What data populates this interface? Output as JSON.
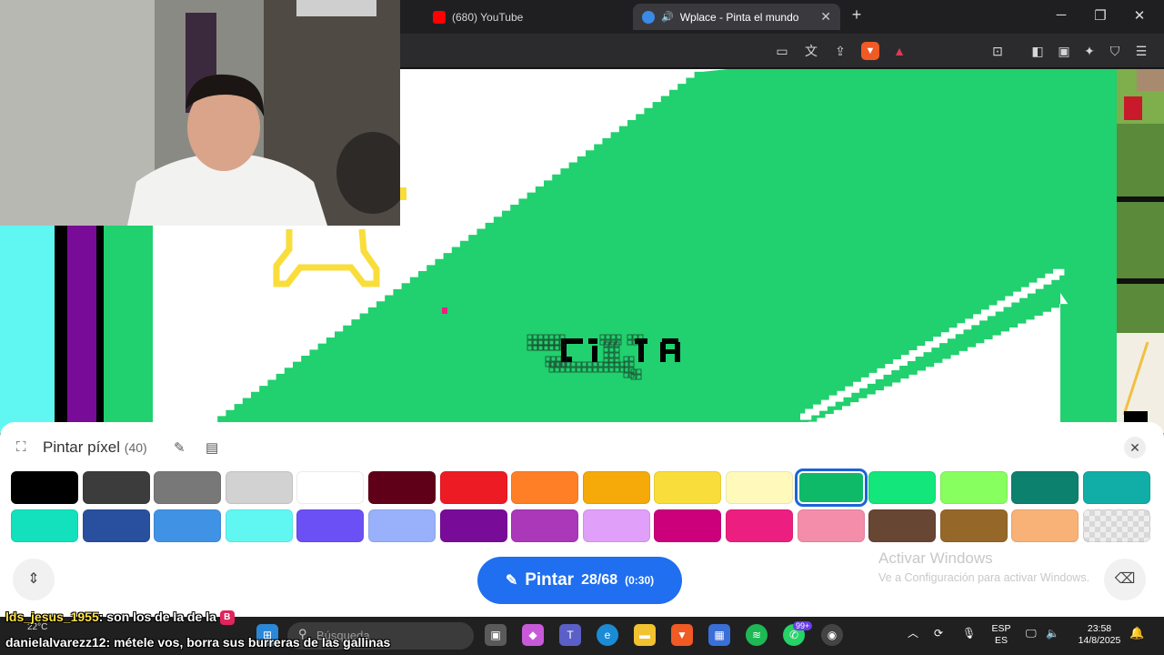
{
  "browser": {
    "tabs": [
      {
        "label": "(680) YouTube"
      },
      {
        "label": "Wplace - Pinta el mundo"
      }
    ]
  },
  "panel": {
    "title": "Pintar píxel",
    "count": "(40)",
    "palette": [
      {
        "color": "#000000"
      },
      {
        "color": "#3c3c3c"
      },
      {
        "color": "#787878"
      },
      {
        "color": "#d2d2d2"
      },
      {
        "color": "#ffffff"
      },
      {
        "color": "#600018"
      },
      {
        "color": "#ed1c24"
      },
      {
        "color": "#ff7f27"
      },
      {
        "color": "#f6aa09"
      },
      {
        "color": "#f9dd3b"
      },
      {
        "color": "#fffabc"
      },
      {
        "color": "#0eb968"
      },
      {
        "color": "#13e67b"
      },
      {
        "color": "#87ff5e"
      },
      {
        "color": "#0c816e"
      },
      {
        "color": "#10aea6"
      },
      {
        "color": "#13e1be"
      },
      {
        "color": "#28509e"
      },
      {
        "color": "#4093e4"
      },
      {
        "color": "#60f7f2"
      },
      {
        "color": "#6b50f6"
      },
      {
        "color": "#99b1fb"
      },
      {
        "color": "#780c99"
      },
      {
        "color": "#aa38b9"
      },
      {
        "color": "#e09ff9"
      },
      {
        "color": "#cb007a"
      },
      {
        "color": "#ec1f80"
      },
      {
        "color": "#f38da9"
      },
      {
        "color": "#684634"
      },
      {
        "color": "#95682a"
      },
      {
        "color": "#f8b277"
      },
      {
        "color": "transparent"
      }
    ],
    "selected_index": 11,
    "paint_button": {
      "label": "Pintar",
      "progress": "28/68",
      "timer": "(0:30)"
    }
  },
  "watermark": {
    "line1": "Activar Windows",
    "line2": "Ve a Configuración para activar Windows."
  },
  "taskbar": {
    "search_placeholder": "Búsqueda",
    "weather": "22°C",
    "badge": "99+",
    "lang1": "ESP",
    "lang2": "ES",
    "time": "23:58",
    "date": "14/8/2025"
  },
  "chat": [
    {
      "user": "lds_jesus_1955",
      "message": ": son los de la de la",
      "badge": "B"
    },
    {
      "user": "danielalvarezz12",
      "message": ": métele vos, borra sus burreras de las gallinas"
    }
  ],
  "colors": {
    "canvas_green": "#21d06e",
    "accent_blue": "#1f6ff0"
  }
}
